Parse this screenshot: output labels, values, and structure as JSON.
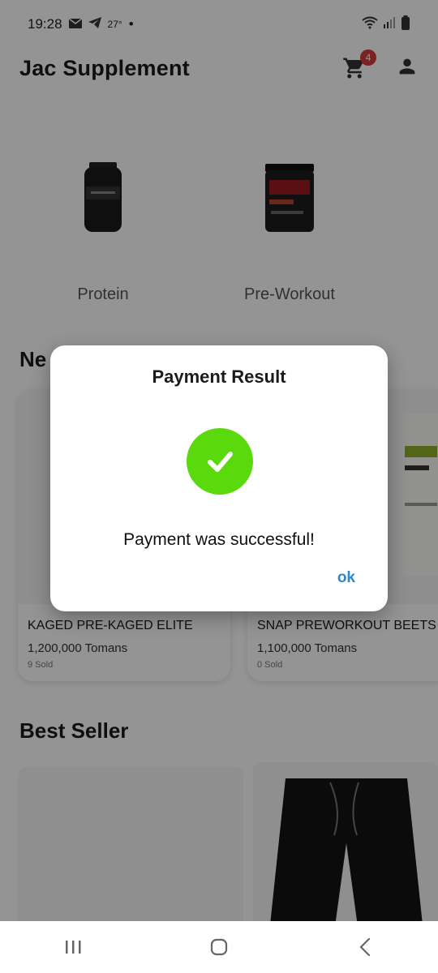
{
  "status": {
    "time": "19:28",
    "temp": "27°"
  },
  "app": {
    "title": "Jac Supplement",
    "cart_count": "4"
  },
  "categories": [
    {
      "label": "Protein"
    },
    {
      "label": "Pre-Workout"
    }
  ],
  "sections": {
    "new_title": "Ne",
    "best_title": "Best Seller"
  },
  "products": [
    {
      "name": "KAGED PRE-KAGED ELITE",
      "price": "1,200,000 Tomans",
      "sold": "9 Sold"
    },
    {
      "name": "SNAP  PREWORKOUT BEETS",
      "price": "1,100,000 Tomans",
      "sold": "0 Sold"
    }
  ],
  "dialog": {
    "title": "Payment Result",
    "message": "Payment was successful!",
    "ok_label": "ok"
  },
  "colors": {
    "success": "#5ad90c",
    "link": "#2f86c8",
    "badge": "#d23a3a"
  }
}
